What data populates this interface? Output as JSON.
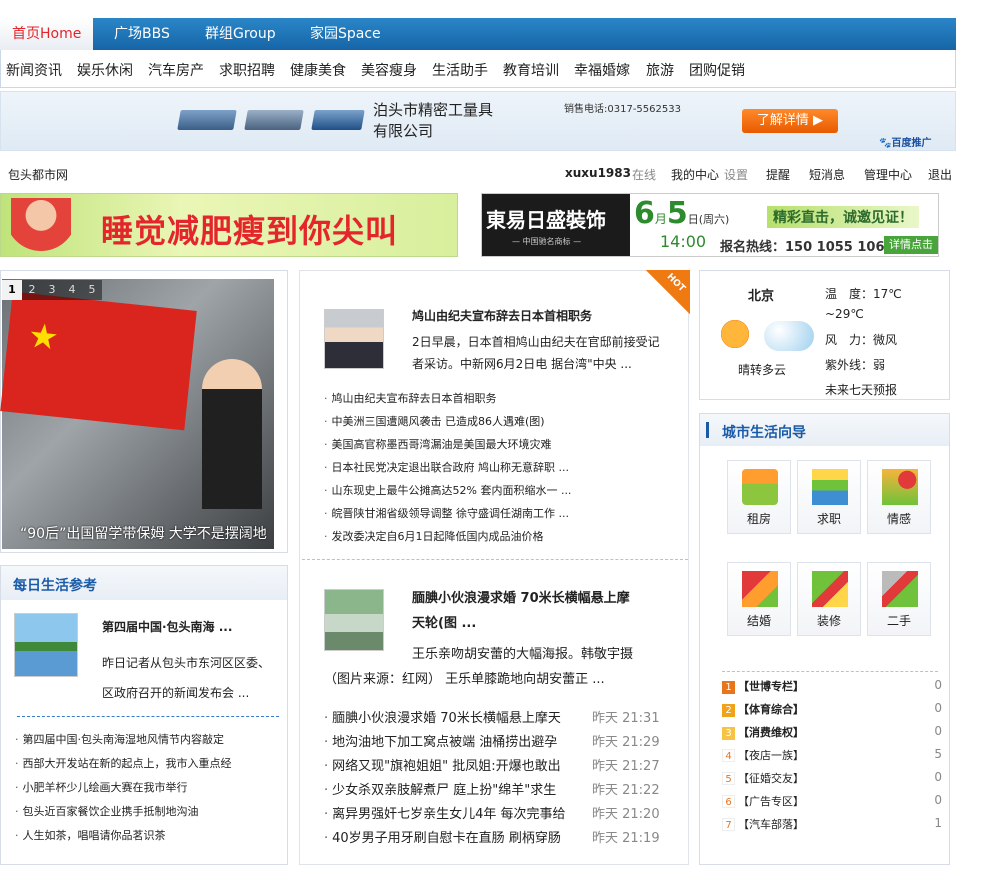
{
  "topnav": {
    "items": [
      "首页Home",
      "广场BBS",
      "群组Group",
      "家园Space"
    ]
  },
  "subnav": {
    "items": [
      "新闻资讯",
      "娱乐休闲",
      "汽车房产",
      "求职招聘",
      "健康美食",
      "美容瘦身",
      "生活助手",
      "教育培训",
      "幸福婚嫁",
      "旅游",
      "团购促销"
    ]
  },
  "banner1": {
    "company": "泊头市精密工量具\n有限公司",
    "company_line1": "泊头市精密工量具",
    "company_line2": "有限公司",
    "phone": "销售电话:0317-5562533",
    "cta": "了解详情 ▶",
    "badge": "百度推广"
  },
  "infobar": {
    "site": "包头都市网",
    "username": "xuxu1983",
    "status": "在线",
    "my_center": "我的中心",
    "settings": "设置",
    "remind": "提醒",
    "sms": "短消息",
    "admin": "管理中心",
    "logout": "退出"
  },
  "banner2": {
    "text": "睡觉减肥瘦到你尖叫"
  },
  "banner3": {
    "brand": "東易日盛裝饰",
    "brand_sub": "— 中国驰名商标 —",
    "date": "6月5日(周六)",
    "date_big": "6",
    "date_day": "5",
    "date_week": "日(周六)",
    "time": "14:00",
    "slogan": "精彩直击，诚邀见证！",
    "hotline": "报名热线：150 1055 1066",
    "cta": "详情点击"
  },
  "slideshow": {
    "pages": [
      "1",
      "2",
      "3",
      "4",
      "5"
    ],
    "caption": "“90后”出国留学带保姆 大学不是摆阔地"
  },
  "daily": {
    "title": "每日生活参考",
    "featured_title": "第四届中国·包头南海 ...",
    "featured_desc1": "昨日记者从包头市东河区区委、",
    "featured_desc2": "区政府召开的新闻发布会 ...",
    "items": [
      "第四届中国·包头南海湿地风情节内容敲定",
      "西部大开发站在新的起点上，我市入重点经",
      "小肥羊杯少儿绘画大赛在我市举行",
      "包头近百家餐饮企业携手抵制地沟油",
      "人生如茶，唱唱请你品茗识茶"
    ]
  },
  "news1": {
    "badge": "HOT",
    "title": "鸠山由纪夫宣布辞去日本首相职务",
    "desc1": "2日早晨，日本首相鸠山由纪夫在官邸前接受记",
    "desc2": "者采访。中新网6月2日电 据台湾\"中央 ...",
    "items": [
      "鸠山由纪夫宣布辞去日本首相职务",
      "中美洲三国遭飓风袭击 已造成86人遇难(图)",
      "美国高官称墨西哥湾漏油是美国最大环境灾难",
      "日本社民党决定退出联合政府 鸠山称无意辞职 ...",
      "山东现史上最牛公摊高达52% 套内面积缩水一 ...",
      "皖晋陕甘湘省级领导调整 徐守盛调任湖南工作 ...",
      "发改委决定自6月1日起降低国内成品油价格"
    ]
  },
  "news2": {
    "title1": "腼腆小伙浪漫求婚 70米长横幅悬上摩",
    "title2": "天轮(图 ...",
    "desc1": "王乐亲吻胡安蕾的大幅海报。韩敬宇摄",
    "desc2": "（图片来源：红网） 王乐单膝跪地向胡安蕾正 ...",
    "items": [
      {
        "text": "腼腆小伙浪漫求婚 70米长横幅悬上摩天",
        "time": "昨天 21:31"
      },
      {
        "text": "地沟油地下加工窝点被端 油桶捞出避孕",
        "time": "昨天 21:29"
      },
      {
        "text": "网络又现\"旗袍姐姐\" 批凤姐:开爆也敢出",
        "time": "昨天 21:27"
      },
      {
        "text": "少女杀双亲肢解煮尸 庭上扮\"绵羊\"求生",
        "time": "昨天 21:22"
      },
      {
        "text": "离异男强奸七岁亲生女儿4年 每次完事给",
        "time": "昨天 21:20"
      },
      {
        "text": "40岁男子用牙刷自慰卡在直肠 刷柄穿肠",
        "time": "昨天 21:19"
      }
    ]
  },
  "weather": {
    "city": "北京",
    "temp1": "温　度：17℃",
    "temp2": "~29℃",
    "wind": "风　力：微风",
    "uv": "紫外线：弱",
    "desc": "晴转多云",
    "more": "未来七天预报"
  },
  "guide": {
    "title": "城市生活向导",
    "icons": [
      {
        "label": "租房",
        "icon": "house-icon"
      },
      {
        "label": "求职",
        "icon": "books-icon"
      },
      {
        "label": "情感",
        "icon": "heart-icon"
      },
      {
        "label": "结婚",
        "icon": "ribbon-icon"
      },
      {
        "label": "装修",
        "icon": "hammer-icon"
      },
      {
        "label": "二手",
        "icon": "goods-icon"
      }
    ],
    "boards": [
      {
        "num": "1",
        "name": "【世博专栏】",
        "count": "0"
      },
      {
        "num": "2",
        "name": "【体育综合】",
        "count": "0"
      },
      {
        "num": "3",
        "name": "【消费维权】",
        "count": "0"
      },
      {
        "num": "4",
        "name": "【夜店一族】",
        "count": "5"
      },
      {
        "num": "5",
        "name": "【征婚交友】",
        "count": "0"
      },
      {
        "num": "6",
        "name": "【广告专区】",
        "count": "0"
      },
      {
        "num": "7",
        "name": "【汽车部落】",
        "count": "1"
      }
    ],
    "colors": {
      "top": "#e8741b",
      "rest": "#bbbbbb"
    }
  }
}
